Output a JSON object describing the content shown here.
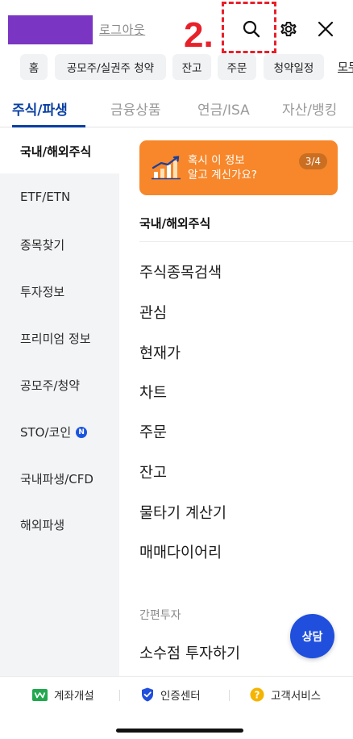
{
  "header": {
    "logout_label": "로그아웃",
    "step_label": "2.",
    "icons": [
      "search-icon",
      "gear-icon",
      "close-icon"
    ]
  },
  "chips": [
    "홈",
    "공모주/실권주 청약",
    "잔고",
    "주문",
    "청약일정",
    "모두"
  ],
  "tabs": [
    "주식/파생",
    "금융상품",
    "연금/ISA",
    "자산/뱅킹"
  ],
  "leftnav": {
    "items": [
      "국내/해외주식",
      "ETF/ETN",
      "종목찾기",
      "투자정보",
      "프리미엄 정보",
      "공모주/청약",
      "STO/코인",
      "국내파생/CFD",
      "해외파생"
    ],
    "new_badge": "N"
  },
  "banner": {
    "line1": "혹시 이 정보",
    "line2": "알고 계신가요?",
    "pager": "3/4"
  },
  "section": {
    "title": "국내/해외주식",
    "items": [
      "주식종목검색",
      "관심",
      "현재가",
      "차트",
      "주문",
      "잔고",
      "물타기 계산기",
      "매매다이어리"
    ],
    "sub_title": "간편투자",
    "sub_items": [
      "소수점 투자하기"
    ]
  },
  "consult_label": "상담",
  "footer": {
    "items": [
      "계좌개설",
      "인증센터",
      "고객서비스"
    ]
  },
  "colors": {
    "accent_blue": "#0a3fa3",
    "banner_orange": "#f7872a",
    "step_red": "#e8202a",
    "avatar_purple": "#7a35c3"
  }
}
